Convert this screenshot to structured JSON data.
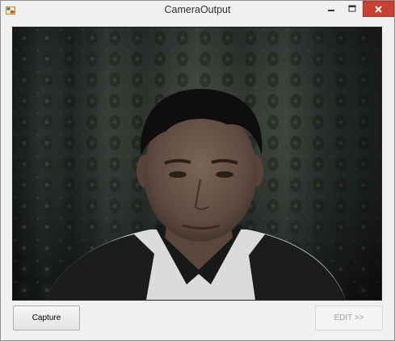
{
  "window": {
    "title": "CameraOutput",
    "close_color": "#c84031"
  },
  "camera": {
    "icon": "webcam-feed-image"
  },
  "buttons": {
    "capture": "Capture",
    "edit": "EDIT >>"
  }
}
